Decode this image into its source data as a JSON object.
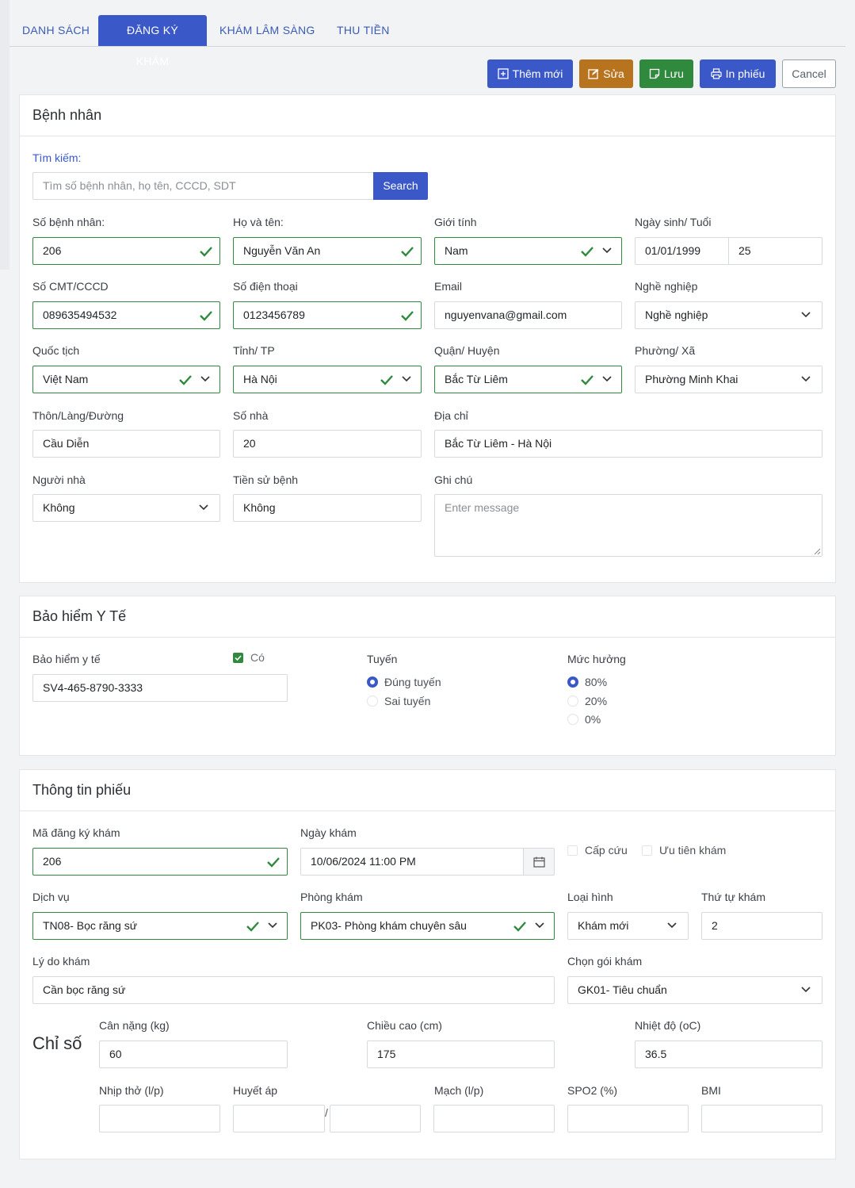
{
  "tabs": [
    "DANH SÁCH",
    "ĐĂNG KÝ KHÁM",
    "KHÁM LÂM SÀNG",
    "THU TIỀN"
  ],
  "toolbar": {
    "add": "Thêm mới",
    "edit": "Sửa",
    "save": "Lưu",
    "print": "In phiếu",
    "cancel": "Cancel"
  },
  "patient": {
    "title": "Bệnh nhân",
    "search_label": "Tìm kiếm:",
    "search_placeholder": "Tìm số bệnh nhân, họ tên, CCCD, SDT",
    "search_button": "Search",
    "patient_no_label": "Số bệnh nhân:",
    "patient_no": "206",
    "name_label": "Họ và tên:",
    "name": "Nguyễn Văn An",
    "gender_label": "Giới tính",
    "gender": "Nam",
    "dob_label": "Ngày sinh/ Tuổi",
    "dob": "01/01/1999",
    "age": "25",
    "id_label": "Số CMT/CCCD",
    "id_no": "089635494532",
    "phone_label": "Số điện thoại",
    "phone": "0123456789",
    "email_label": "Email",
    "email": "nguyenvana@gmail.com",
    "job_label": "Nghề nghiệp",
    "job": "Nghề nghiệp",
    "nation_label": "Quốc tịch",
    "nation": "Việt Nam",
    "province_label": "Tỉnh/ TP",
    "province": "Hà Nội",
    "district_label": "Quận/ Huyện",
    "district": "Bắc Từ Liêm",
    "ward_label": "Phường/ Xã",
    "ward": "Phường Minh Khai",
    "village_label": "Thôn/Làng/Đường",
    "village": "Cầu Diễn",
    "house_label": "Số nhà",
    "house": "20",
    "address_label": "Địa chỉ",
    "address": "Bắc Từ Liêm - Hà Nội",
    "relative_label": "Người nhà",
    "relative": "Không",
    "history_label": "Tiền sử bệnh",
    "history": "Không",
    "note_label": "Ghi chú",
    "note_placeholder": "Enter message"
  },
  "insurance": {
    "title": "Bảo hiểm Y Tế",
    "ins_label": "Bảo hiểm y tế",
    "has_label": "Có",
    "ins_no": "SV4-465-8790-3333",
    "route_label": "Tuyến",
    "routes": [
      "Đúng tuyến",
      "Sai tuyến"
    ],
    "level_label": "Mức hưởng",
    "levels": [
      "80%",
      "20%",
      "0%"
    ]
  },
  "ticket": {
    "title": "Thông tin phiếu",
    "code_label": "Mã đăng ký khám",
    "code": "206",
    "date_label": "Ngày khám",
    "date": "10/06/2024 11:00 PM",
    "emergency": "Cấp cứu",
    "priority": "Ưu tiên khám",
    "service_label": "Dịch vụ",
    "service": "TN08- Bọc răng sứ",
    "room_label": "Phòng khám",
    "room": "PK03- Phòng khám chuyên sâu",
    "type_label": "Loại hình",
    "type": "Khám mới",
    "order_label": "Thứ tự khám",
    "order": "2",
    "reason_label": "Lý do khám",
    "reason": "Cần bọc răng sứ",
    "package_label": "Chọn gói khám",
    "package": "GK01- Tiêu chuẩn",
    "vitals_title": "Chỉ số",
    "weight_label": "Cân nặng (kg)",
    "weight": "60",
    "height_label": "Chiều cao (cm)",
    "height": "175",
    "temp_label": "Nhiệt độ (oC)",
    "temp": "36.5",
    "breath_label": "Nhịp thở (l/p)",
    "bp_label": "Huyết áp",
    "bp_sep": "/",
    "pulse_label": "Mạch (l/p)",
    "spo2_label": "SPO2 (%)",
    "bmi_label": "BMI"
  },
  "colors": {
    "primary": "#3a58c8",
    "edit": "#b8731f",
    "save": "#2f8a3e",
    "valid": "#2f8a3e"
  }
}
